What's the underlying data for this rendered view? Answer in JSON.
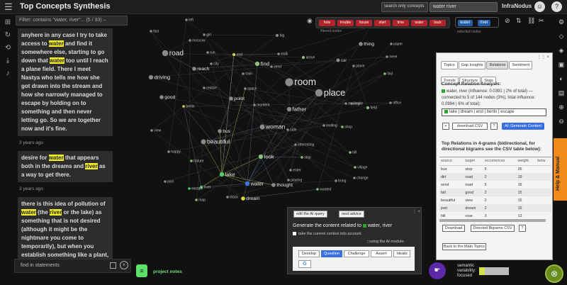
{
  "app": {
    "title": "Top Concepts Synthesis",
    "brand": "InfraNodus"
  },
  "search": {
    "mode": "search only concepts",
    "query": "water river"
  },
  "filter": {
    "text": "Filter: contains \"water, river\"... (5 / 33) –"
  },
  "statements": [
    {
      "segments": [
        [
          "anyhere in any case I try to take access to ",
          0
        ],
        [
          "water",
          1
        ],
        [
          " and find it somewhere else, starting to go down that ",
          0
        ],
        [
          "water",
          1
        ],
        [
          " too until I reach a plane field. There I meet Nastya who tells me how she got drawn into the stream and how she narrowly managed to escape by holding on to something and then never letting go. So we are together now and it's fine.",
          0
        ]
      ],
      "time": "3 years ago"
    },
    {
      "segments": [
        [
          "desire for ",
          0
        ],
        [
          "water",
          1
        ],
        [
          " that appears both in the dreams and ",
          0
        ],
        [
          "river",
          1
        ],
        [
          " as a way to get there.",
          0
        ]
      ],
      "time": "3 years ago"
    },
    {
      "segments": [
        [
          "there is this idea of pollution of ",
          0
        ],
        [
          "water",
          1
        ],
        [
          " (the ",
          0
        ],
        [
          "river",
          1
        ],
        [
          " or the lake) as something that is not desired (although it might be the nightmare you come to temporarily), but when you establish something like a plant, it will grow and clear the area. although if it requires more than",
          0
        ]
      ],
      "time": ""
    }
  ],
  "find": {
    "placeholder": "find in statements"
  },
  "notes": {
    "label": "project notes"
  },
  "graph": {
    "nodes": [
      {
        "label": "room",
        "size": 16
      },
      {
        "label": "place",
        "size": 15
      },
      {
        "label": "road",
        "size": 12
      },
      {
        "label": "beautiful",
        "size": 10
      },
      {
        "label": "woman",
        "size": 10
      },
      {
        "label": "father",
        "size": 9
      },
      {
        "label": "find",
        "size": 9
      },
      {
        "label": "reach",
        "size": 8
      },
      {
        "label": "driving",
        "size": 9
      },
      {
        "label": "good",
        "size": 8
      },
      {
        "label": "point",
        "size": 8
      },
      {
        "label": "bus",
        "size": 8
      },
      {
        "label": "lake",
        "size": 9
      },
      {
        "label": "water",
        "size": 9
      },
      {
        "label": "thought",
        "size": 8
      },
      {
        "label": "dream",
        "size": 8
      },
      {
        "label": "look",
        "size": 9
      },
      {
        "label": "thing",
        "size": 8
      },
      {
        "label": "car",
        "size": 7
      },
      {
        "label": "big",
        "size": 6
      },
      {
        "label": "fast",
        "size": 5
      },
      {
        "label": "left",
        "size": 5
      },
      {
        "label": "girl",
        "size": 5
      },
      {
        "label": "moscow",
        "size": 5
      },
      {
        "label": "city",
        "size": 5
      },
      {
        "label": "end",
        "size": 6
      },
      {
        "label": "walk",
        "size": 5
      },
      {
        "label": "arrive",
        "size": 6
      },
      {
        "label": "plane",
        "size": 5
      },
      {
        "label": "meet",
        "size": 5
      },
      {
        "label": "paper",
        "size": 5
      },
      {
        "label": "case",
        "size": 6
      },
      {
        "label": "space",
        "size": 5
      },
      {
        "label": "realize",
        "size": 5
      },
      {
        "label": "moment",
        "size": 5
      },
      {
        "label": "making",
        "size": 5
      },
      {
        "label": "inside",
        "size": 5
      },
      {
        "label": "field",
        "size": 6
      },
      {
        "label": "office",
        "size": 5
      },
      {
        "label": "berlin",
        "size": 5
      },
      {
        "label": "shop",
        "size": 5
      },
      {
        "label": "waiting",
        "size": 5
      },
      {
        "label": "view",
        "size": 5
      },
      {
        "label": "side",
        "size": 5
      },
      {
        "label": "happy",
        "size": 5
      },
      {
        "label": "interesting",
        "size": 5
      },
      {
        "label": "nature",
        "size": 5
      },
      {
        "label": "stop",
        "size": 5
      },
      {
        "label": "hill",
        "size": 5
      },
      {
        "label": "village",
        "size": 5
      },
      {
        "label": "change",
        "size": 5
      },
      {
        "label": "bring",
        "size": 5
      },
      {
        "label": "enter",
        "size": 5
      },
      {
        "label": "river",
        "size": 6
      },
      {
        "label": "escape",
        "size": 5
      },
      {
        "label": "playing",
        "size": 5
      },
      {
        "label": "part",
        "size": 5
      },
      {
        "label": "wanted",
        "size": 5
      },
      {
        "label": "map",
        "size": 5
      },
      {
        "label": "black",
        "size": 5
      },
      {
        "label": "run",
        "size": 5
      },
      {
        "label": "send",
        "size": 5
      },
      {
        "label": "train",
        "size": 5
      },
      {
        "label": "find",
        "size": 5
      }
    ]
  },
  "filter_chips": [
    "hole",
    "trouble",
    "house",
    "start",
    "time",
    "water",
    "back"
  ],
  "filter_chips_label": "filtered nodes",
  "selected": {
    "label": "selected nodes",
    "chips": [
      "water",
      "river"
    ]
  },
  "panel": {
    "tabs": [
      "Topics",
      "Gap Insights",
      "Relations",
      "Sentiment",
      "Trends",
      "Structure",
      "Stats"
    ],
    "active_tab": "Relations",
    "relation_title": "Concept Relation Analysis:",
    "relation_text": "water, river (influence: 0.0391 | 2% of total) — connected to 5 of 144 nodes (3%), total influence: 0.0994 | 6% of total):",
    "related_terms": "lake | dream | end | berlin | escape",
    "download_csv": "download CSV",
    "help": "?",
    "ai_generate": "AI: Generate Content",
    "ngrams_title": "Top Relations in 4-grams (bidirectional, for directional bigrams see the CSV table below):",
    "columns": [
      "source",
      "target",
      "occurrences",
      "weight",
      "betw"
    ],
    "rows": [
      [
        "bus",
        "stop",
        "5",
        "26",
        ""
      ],
      [
        "dirt",
        "road",
        "2",
        "19",
        ""
      ],
      [
        "send",
        "road",
        "5",
        "16",
        ""
      ],
      [
        "fall",
        "good",
        "2",
        "15",
        ""
      ],
      [
        "beautiful",
        "view",
        "2",
        "15",
        ""
      ],
      [
        "part",
        "dream",
        "2",
        "15",
        ""
      ],
      [
        "hill",
        "rose",
        "3",
        "13",
        ""
      ]
    ],
    "download": "Download",
    "directed": "Directed Bigrams CSV",
    "back": "Back to the Main Topics"
  },
  "ai": {
    "edit": "edit the AI query",
    "next": "next advice",
    "generate": "Generate the content related to",
    "terms": "water, river",
    "checkbox": "take the current context into account",
    "using": "using the AI module:",
    "modes": [
      "Develop",
      "Question",
      "Challenge",
      "Assert",
      "Ideate"
    ],
    "active_mode": "Question"
  },
  "help_tab": "Help & Manual",
  "semantic": {
    "label": "semantic variability: focused",
    "line1": "semantic",
    "line2": "variability:",
    "line3": "focused",
    "level": 0.2
  },
  "colors": {
    "highlight": "#f4f028",
    "accent": "#3a6fe0",
    "chip": "#b3242a",
    "help": "#f08a18"
  }
}
